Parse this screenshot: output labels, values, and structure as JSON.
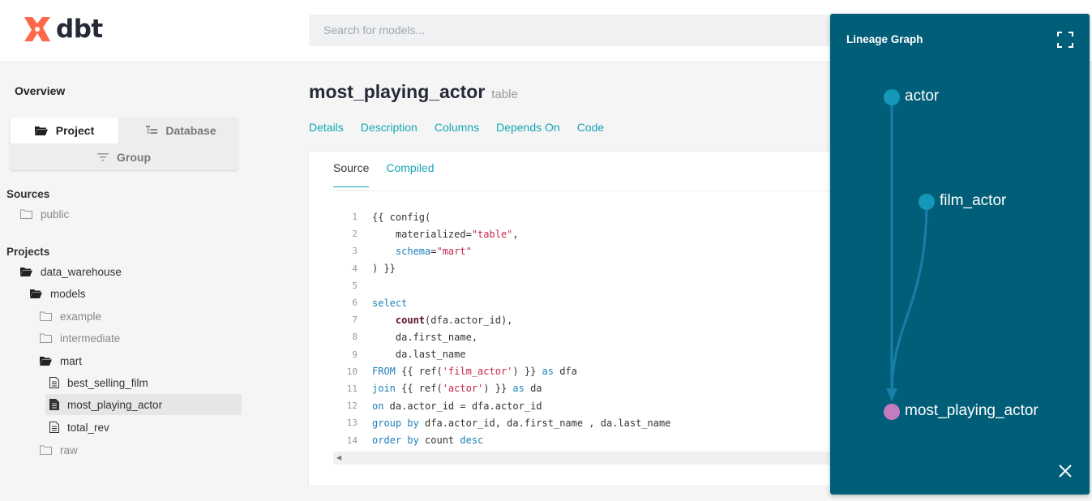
{
  "app": {
    "logo_text": "dbt"
  },
  "search": {
    "placeholder": "Search for models..."
  },
  "sidebar": {
    "overview": "Overview",
    "segments": {
      "project": "Project",
      "database": "Database",
      "group": "Group"
    },
    "sources_heading": "Sources",
    "sources": [
      {
        "label": "public"
      }
    ],
    "projects_heading": "Projects",
    "tree": {
      "project": "data_warehouse",
      "models": "models",
      "example": "example",
      "intermediate": "intermediate",
      "mart": "mart",
      "mart_items": [
        "best_selling_film",
        "most_playing_actor",
        "total_rev"
      ],
      "raw": "raw"
    },
    "selected": "most_playing_actor"
  },
  "model": {
    "name": "most_playing_actor",
    "materialization": "table",
    "nav": [
      "Details",
      "Description",
      "Columns",
      "Depends On",
      "Code"
    ]
  },
  "code_tabs": {
    "source": "Source",
    "compiled": "Compiled"
  },
  "code": {
    "line_numbers": [
      "1",
      "2",
      "3",
      "4",
      "5",
      "6",
      "7",
      "8",
      "9",
      "10",
      "11",
      "12",
      "13",
      "14"
    ]
  },
  "lineage": {
    "title": "Lineage Graph",
    "nodes": [
      {
        "name": "actor",
        "type": "source",
        "color": "#1497b8"
      },
      {
        "name": "film_actor",
        "type": "source",
        "color": "#1497b8"
      },
      {
        "name": "most_playing_actor",
        "type": "selected",
        "color": "#c57bbd"
      }
    ],
    "edge_color": "#1a7eaa"
  },
  "colors": {
    "accent": "#15a7b5",
    "brand": "#ff694b",
    "panel": "#015e78"
  }
}
